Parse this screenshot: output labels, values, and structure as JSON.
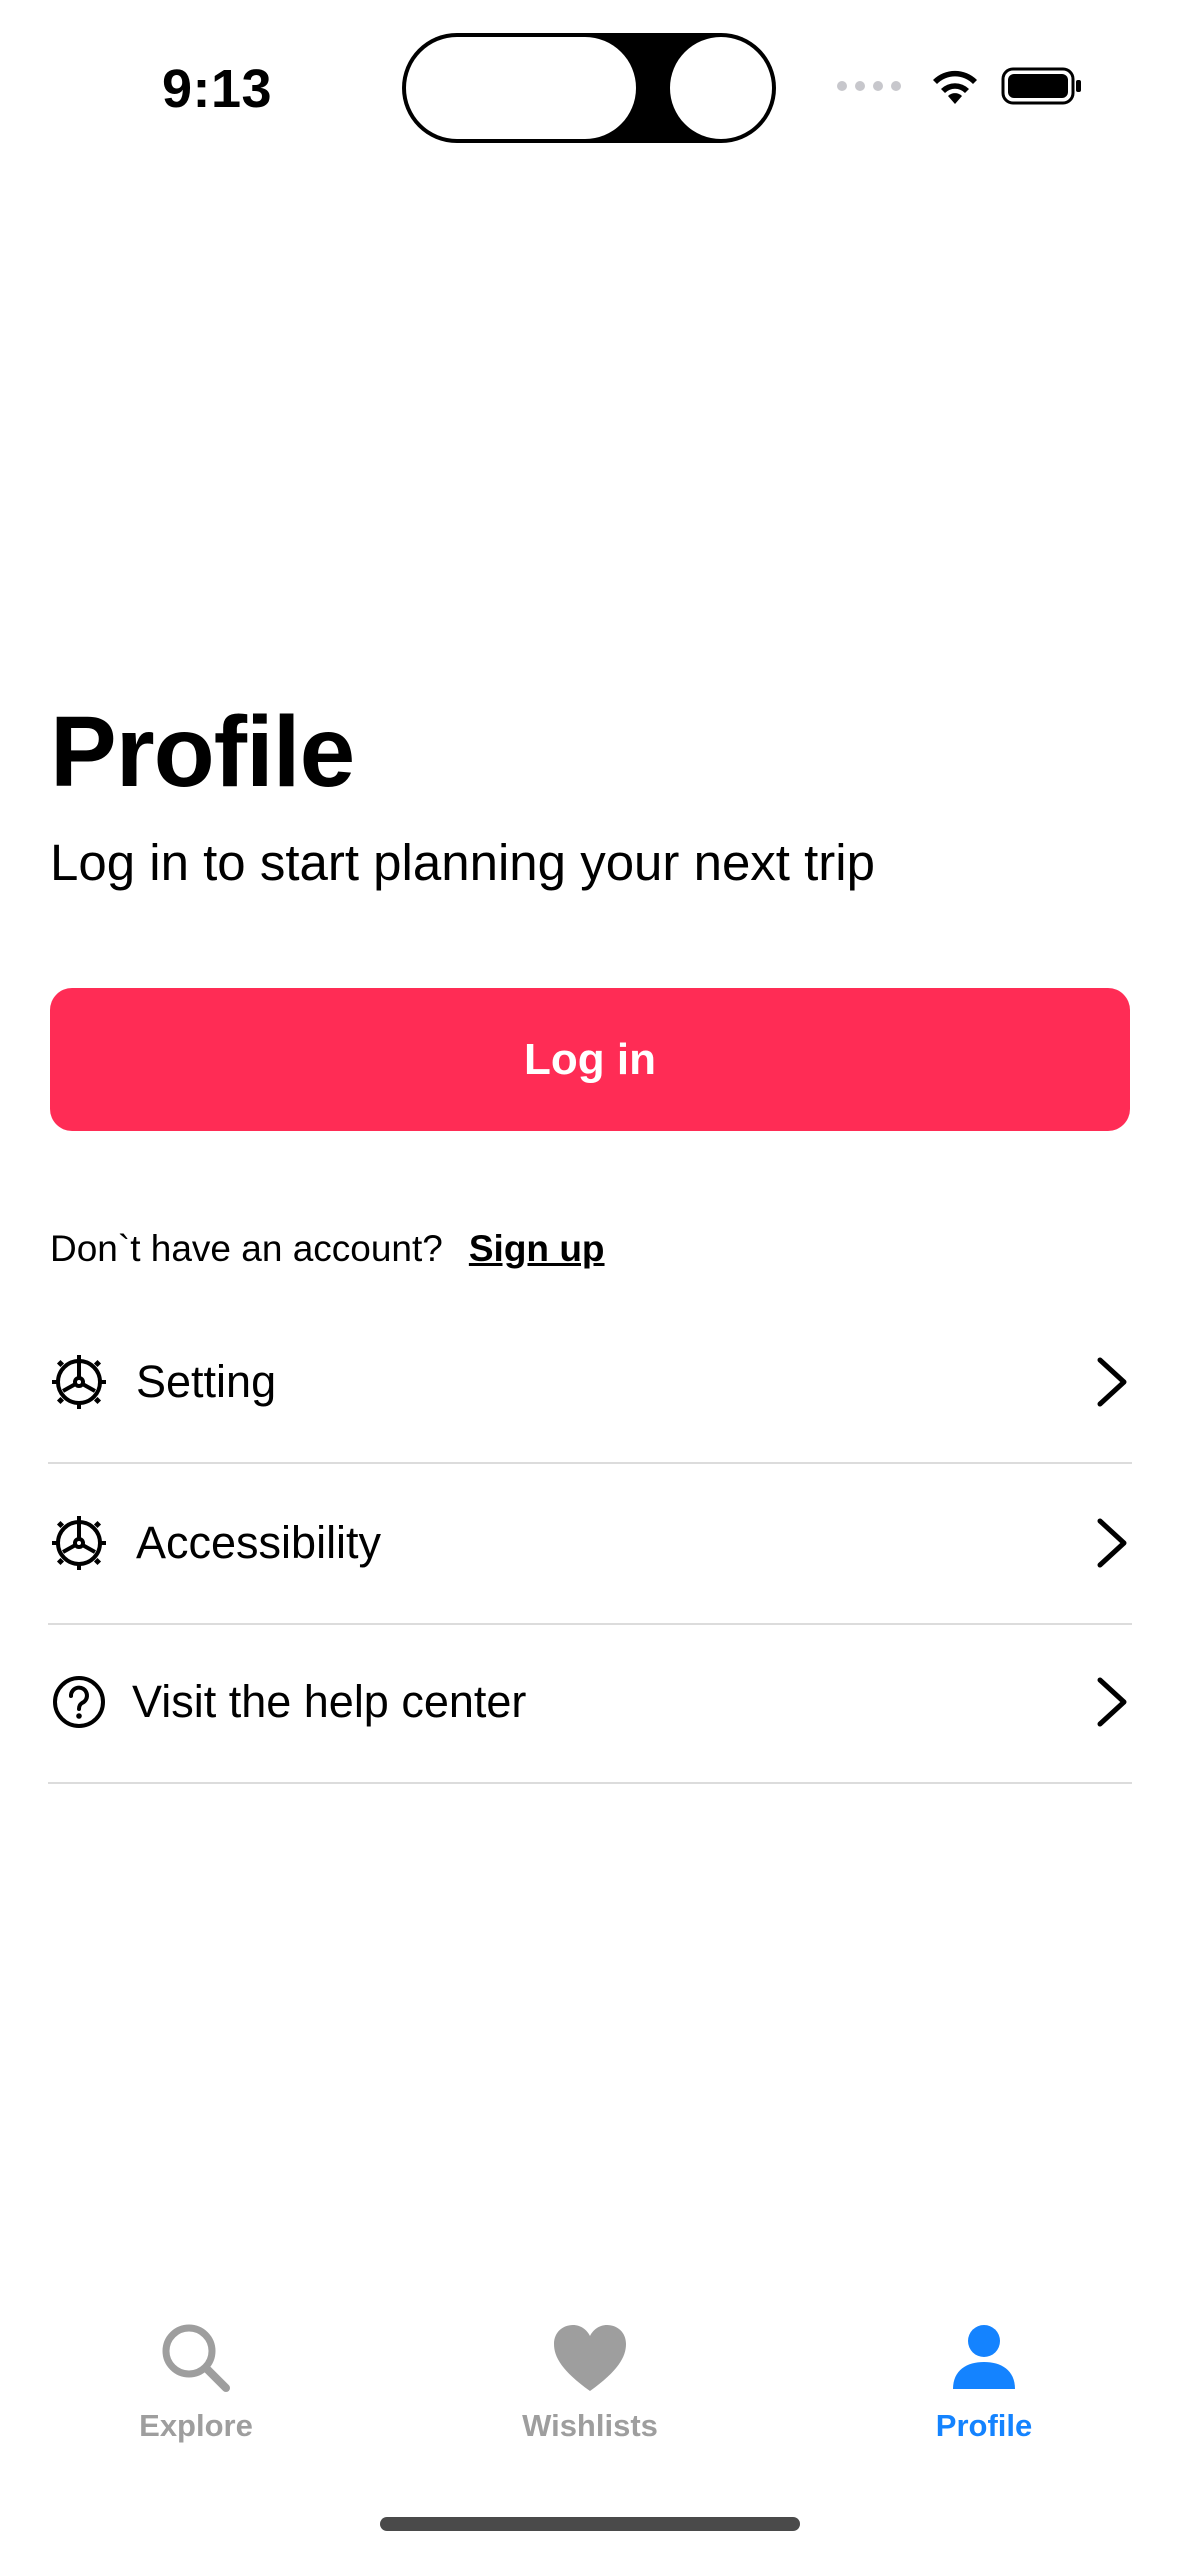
{
  "status_bar": {
    "time": "9:13"
  },
  "header": {
    "title": "Profile",
    "subtitle": "Log in to start planning your next trip"
  },
  "login": {
    "button_label": "Log in",
    "color": "#ff2c55"
  },
  "signup": {
    "prompt": "Don`t have an account?",
    "link_label": "Sign up"
  },
  "menu": {
    "items": [
      {
        "label": "Setting",
        "icon": "gear-icon"
      },
      {
        "label": "Accessibility",
        "icon": "gear-icon"
      },
      {
        "label": "Visit the help center",
        "icon": "question-circle-icon"
      }
    ]
  },
  "tabbar": {
    "tabs": [
      {
        "label": "Explore",
        "icon": "search-icon",
        "active": false
      },
      {
        "label": "Wishlists",
        "icon": "heart-icon",
        "active": false
      },
      {
        "label": "Profile",
        "icon": "person-icon",
        "active": true
      }
    ],
    "active_color": "#1483ff",
    "inactive_color": "#9e9e9e"
  }
}
